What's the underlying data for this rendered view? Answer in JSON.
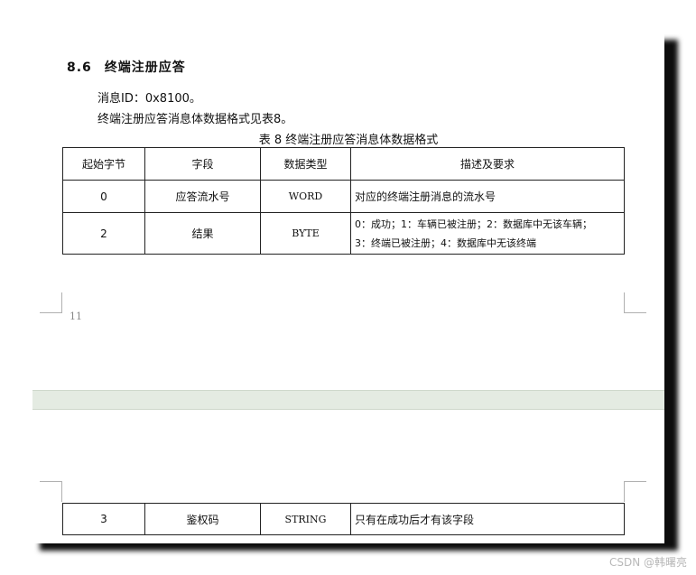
{
  "section": {
    "number": "8.6",
    "title": "终端注册应答"
  },
  "paragraphs": [
    "消息ID：0x8100。",
    "终端注册应答消息体数据格式见表8。"
  ],
  "table_caption": "表 8 终端注册应答消息体数据格式",
  "table": {
    "headers": [
      "起始字节",
      "字段",
      "数据类型",
      "描述及要求"
    ],
    "rows": [
      {
        "start": "0",
        "field": "应答流水号",
        "type": "WORD",
        "desc_lines": [
          "对应的终端注册消息的流水号"
        ]
      },
      {
        "start": "2",
        "field": "结果",
        "type": "BYTE",
        "desc_lines": [
          "0：成功；1：车辆已被注册；2：数据库中无该车辆；",
          "3：终端已被注册；4：数据库中无该终端"
        ]
      }
    ]
  },
  "page_number": "11",
  "next_page_row": {
    "start": "3",
    "field": "鉴权码",
    "type": "STRING",
    "desc_lines": [
      "只有在成功后才有该字段"
    ]
  },
  "watermark": "CSDN @韩曙亮"
}
